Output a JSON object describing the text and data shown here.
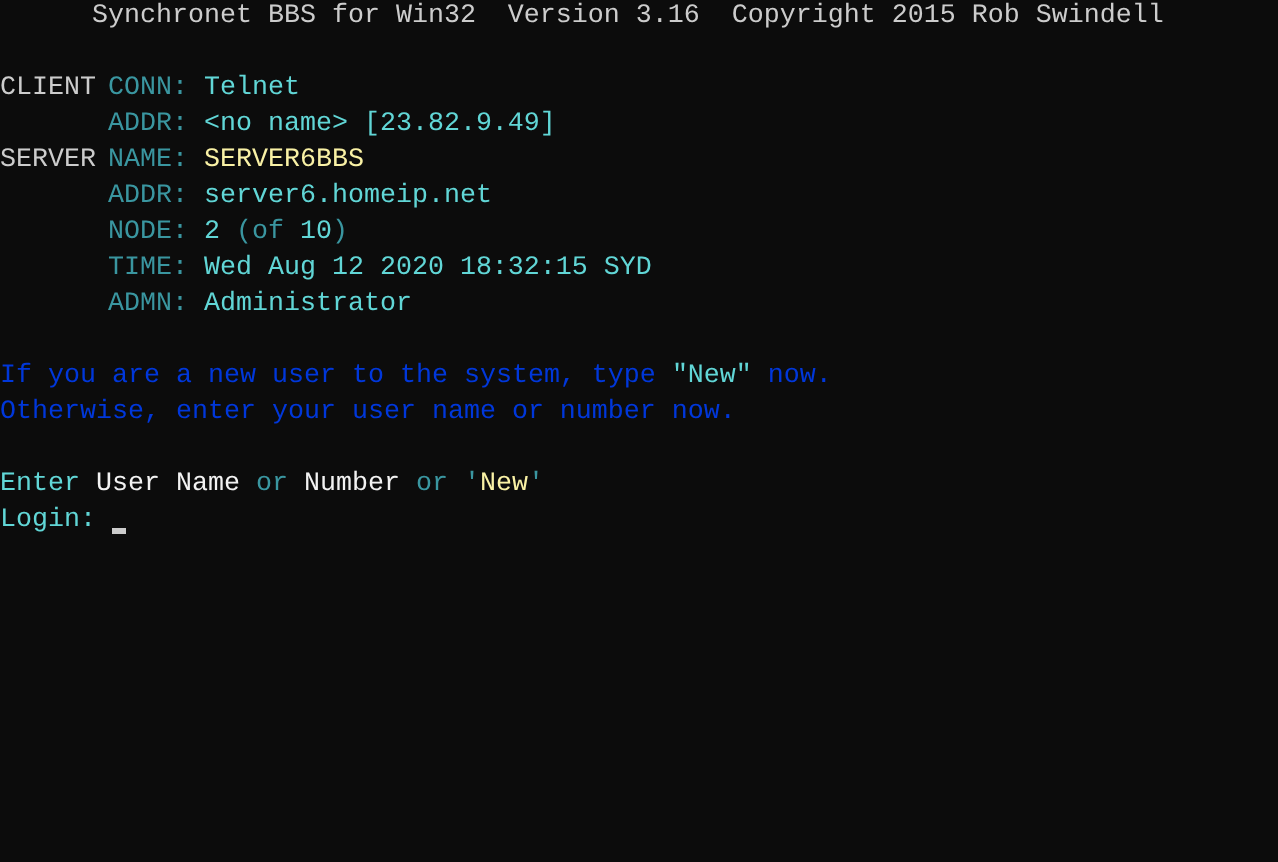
{
  "banner": "Synchronet BBS for Win32  Version 3.16  Copyright 2015 Rob Swindell",
  "info": [
    {
      "section": "CLIENT",
      "label": "CONN:",
      "value": [
        {
          "text": "Telnet",
          "color": "#61d6d6"
        }
      ]
    },
    {
      "label": "ADDR:",
      "value": [
        {
          "text": "<no name> [23.82.9.49]",
          "color": "#61d6d6"
        }
      ]
    },
    {
      "section": "SERVER",
      "label": "NAME:",
      "value": [
        {
          "text": "SERVER6BBS",
          "color": "#f9f1a5"
        }
      ]
    },
    {
      "label": "ADDR:",
      "value": [
        {
          "text": "server6.homeip.net",
          "color": "#61d6d6"
        }
      ]
    },
    {
      "label": "NODE:",
      "value": [
        {
          "text": "2",
          "color": "#61d6d6"
        },
        {
          "text": " (of ",
          "color": "#3a96a0"
        },
        {
          "text": "10",
          "color": "#61d6d6"
        },
        {
          "text": ")",
          "color": "#3a96a0"
        }
      ]
    },
    {
      "label": "TIME:",
      "value": [
        {
          "text": "Wed Aug 12 2020 18:32:15 SYD",
          "color": "#61d6d6"
        }
      ]
    },
    {
      "label": "ADMN:",
      "value": [
        {
          "text": "Administrator",
          "color": "#61d6d6"
        }
      ]
    }
  ],
  "messages": [
    [
      {
        "text": "If you are a new user to the system, type ",
        "color": "#0037da"
      },
      {
        "text": "\"New\"",
        "color": "#61d6d6"
      },
      {
        "text": " now.",
        "color": "#0037da"
      }
    ],
    [
      {
        "text": "Otherwise, enter your user name or number now.",
        "color": "#0037da"
      }
    ]
  ],
  "prompt": [
    {
      "text": "Enter ",
      "color": "#61d6d6"
    },
    {
      "text": "User Name",
      "color": "#f2f2f2"
    },
    {
      "text": " or ",
      "color": "#3a96a0"
    },
    {
      "text": "Number",
      "color": "#f2f2f2"
    },
    {
      "text": " or ",
      "color": "#3a96a0"
    },
    {
      "text": "'",
      "color": "#3a96a0"
    },
    {
      "text": "New",
      "color": "#f9f1a5"
    },
    {
      "text": "'",
      "color": "#3a96a0"
    }
  ],
  "login": {
    "label": "Login:",
    "cursor": true
  }
}
